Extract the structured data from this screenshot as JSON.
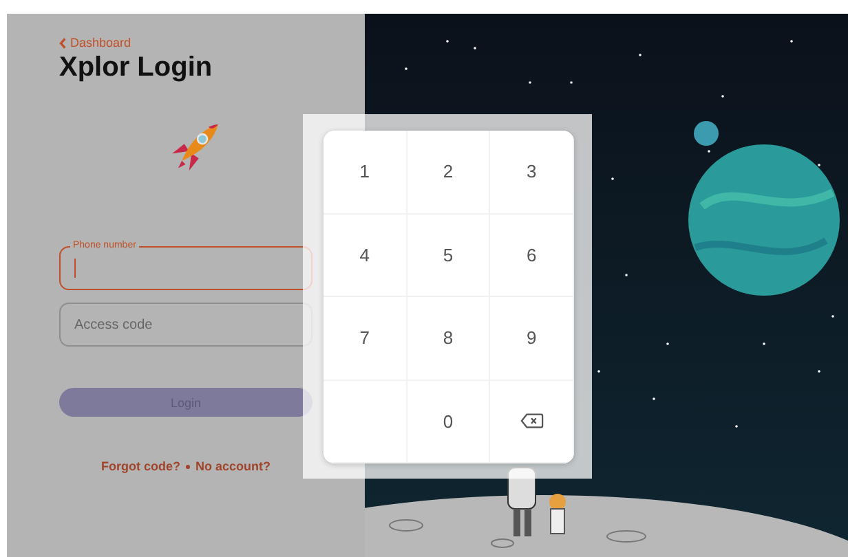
{
  "back_link": {
    "label": "Dashboard"
  },
  "title": "Xplor Login",
  "fields": [
    {
      "kind": "floating",
      "label": "Phone number",
      "focused": true
    },
    {
      "kind": "plain",
      "placeholder": "Access code",
      "focused": false
    }
  ],
  "login_button": {
    "label": "Login",
    "disabled": true
  },
  "links": [
    "Forgot code?",
    "No account?"
  ],
  "keypad": {
    "keys": [
      {
        "kind": "digit",
        "label": "1"
      },
      {
        "kind": "digit",
        "label": "2"
      },
      {
        "kind": "digit",
        "label": "3"
      },
      {
        "kind": "digit",
        "label": "4"
      },
      {
        "kind": "digit",
        "label": "5"
      },
      {
        "kind": "digit",
        "label": "6"
      },
      {
        "kind": "digit",
        "label": "7"
      },
      {
        "kind": "digit",
        "label": "8"
      },
      {
        "kind": "digit",
        "label": "9"
      },
      {
        "kind": "empty"
      },
      {
        "kind": "digit",
        "label": "0"
      },
      {
        "kind": "backspace"
      }
    ]
  }
}
